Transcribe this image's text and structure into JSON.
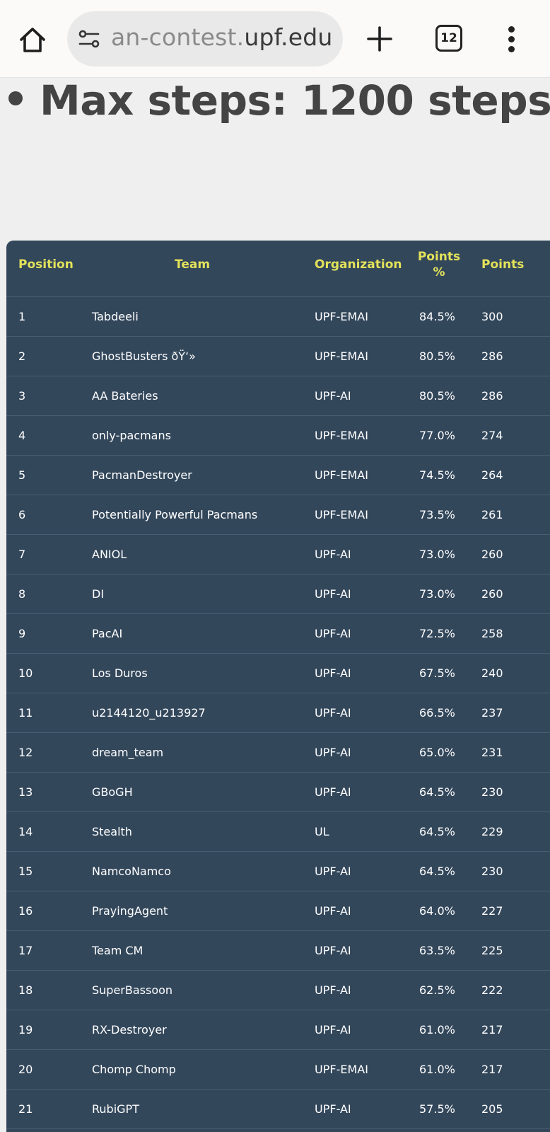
{
  "browser": {
    "url_prefix": "an-contest.",
    "url_domain": "upf.edu",
    "tab_count": "12",
    "icons": [
      "home-icon",
      "site-settings-icon",
      "plus-icon",
      "tabs-icon",
      "more-vert-icon"
    ]
  },
  "page": {
    "heading": "Max steps: 1200 steps"
  },
  "table": {
    "headers": {
      "position": "Position",
      "team": "Team",
      "organization": "Organization",
      "points_pct_line1": "Points",
      "points_pct_line2": "%",
      "points": "Points"
    },
    "rows": [
      {
        "position": "1",
        "team": "Tabdeeli",
        "organization": "UPF-EMAI",
        "pct": "84.5%",
        "points": "300"
      },
      {
        "position": "2",
        "team": "GhostBusters ðŸ‘»",
        "organization": "UPF-EMAI",
        "pct": "80.5%",
        "points": "286"
      },
      {
        "position": "3",
        "team": "AA Bateries",
        "organization": "UPF-AI",
        "pct": "80.5%",
        "points": "286"
      },
      {
        "position": "4",
        "team": "only-pacmans",
        "organization": "UPF-EMAI",
        "pct": "77.0%",
        "points": "274"
      },
      {
        "position": "5",
        "team": "PacmanDestroyer",
        "organization": "UPF-EMAI",
        "pct": "74.5%",
        "points": "264"
      },
      {
        "position": "6",
        "team": "Potentially Powerful Pacmans",
        "organization": "UPF-EMAI",
        "pct": "73.5%",
        "points": "261"
      },
      {
        "position": "7",
        "team": "ANIOL",
        "organization": "UPF-AI",
        "pct": "73.0%",
        "points": "260"
      },
      {
        "position": "8",
        "team": "DI",
        "organization": "UPF-AI",
        "pct": "73.0%",
        "points": "260"
      },
      {
        "position": "9",
        "team": "PacAI",
        "organization": "UPF-AI",
        "pct": "72.5%",
        "points": "258"
      },
      {
        "position": "10",
        "team": "Los Duros",
        "organization": "UPF-AI",
        "pct": "67.5%",
        "points": "240"
      },
      {
        "position": "11",
        "team": "u2144120_u213927",
        "organization": "UPF-AI",
        "pct": "66.5%",
        "points": "237"
      },
      {
        "position": "12",
        "team": "dream_team",
        "organization": "UPF-AI",
        "pct": "65.0%",
        "points": "231"
      },
      {
        "position": "13",
        "team": "GBoGH",
        "organization": "UPF-AI",
        "pct": "64.5%",
        "points": "230"
      },
      {
        "position": "14",
        "team": "Stealth",
        "organization": "UL",
        "pct": "64.5%",
        "points": "229"
      },
      {
        "position": "15",
        "team": "NamcoNamco",
        "organization": "UPF-AI",
        "pct": "64.5%",
        "points": "230"
      },
      {
        "position": "16",
        "team": "PrayingAgent",
        "organization": "UPF-AI",
        "pct": "64.0%",
        "points": "227"
      },
      {
        "position": "17",
        "team": "Team CM",
        "organization": "UPF-AI",
        "pct": "63.5%",
        "points": "225"
      },
      {
        "position": "18",
        "team": "SuperBassoon",
        "organization": "UPF-AI",
        "pct": "62.5%",
        "points": "222"
      },
      {
        "position": "19",
        "team": "RX-Destroyer",
        "organization": "UPF-AI",
        "pct": "61.0%",
        "points": "217"
      },
      {
        "position": "20",
        "team": "Chomp Chomp",
        "organization": "UPF-EMAI",
        "pct": "61.0%",
        "points": "217"
      },
      {
        "position": "21",
        "team": "RubiGPT",
        "organization": "UPF-AI",
        "pct": "57.5%",
        "points": "205"
      }
    ]
  }
}
